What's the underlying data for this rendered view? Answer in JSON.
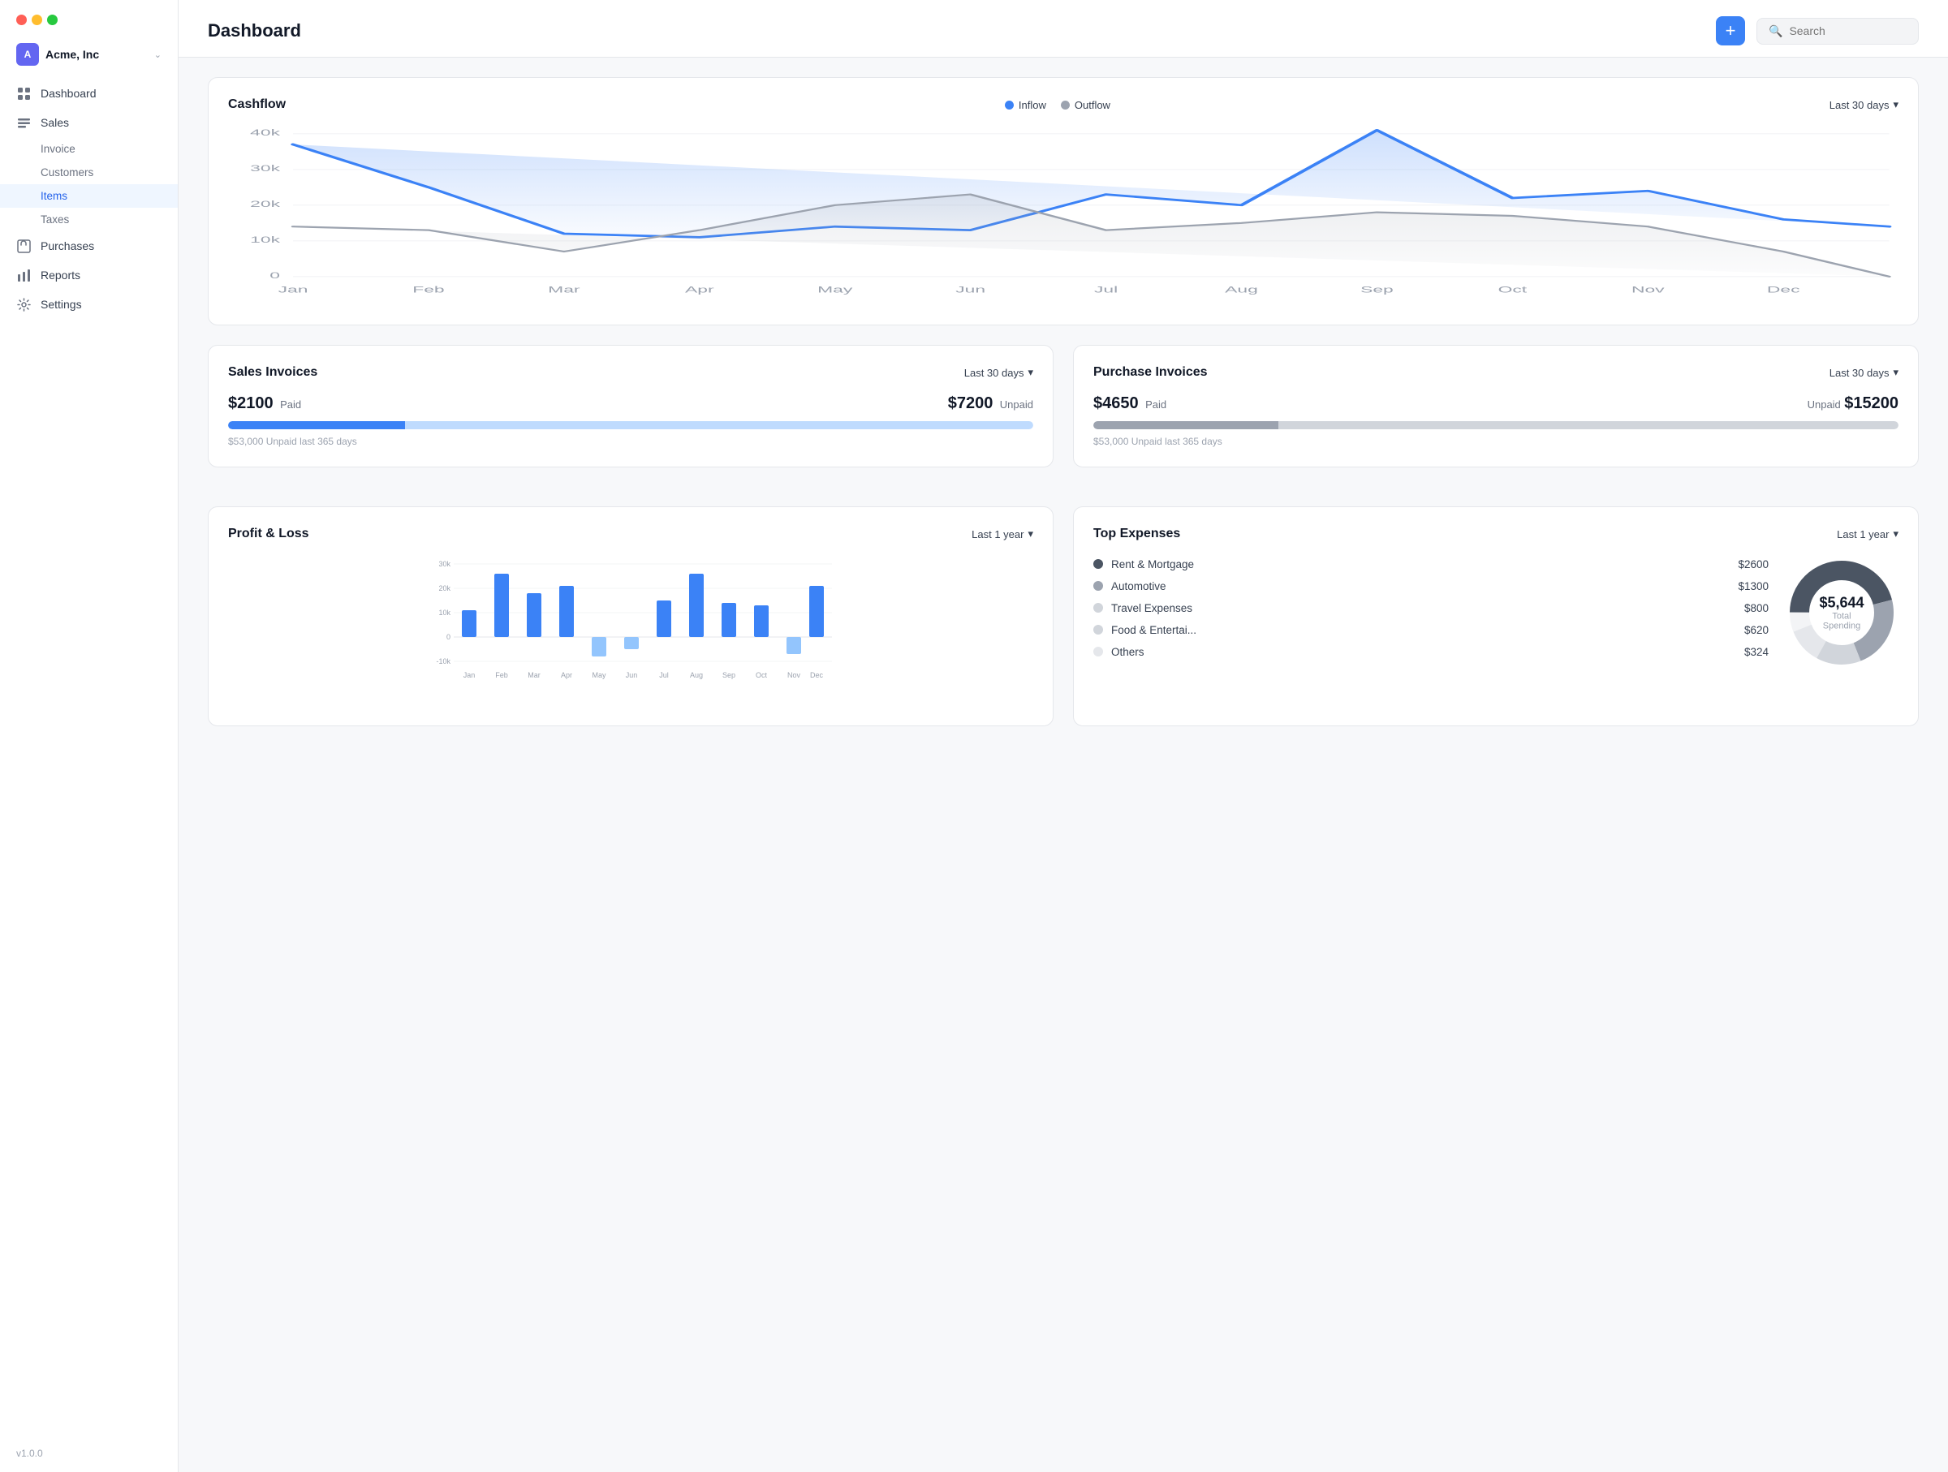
{
  "sidebar": {
    "company": "Acme, Inc",
    "nav": [
      {
        "id": "dashboard",
        "label": "Dashboard",
        "icon": "⊞",
        "active": false,
        "sub": []
      },
      {
        "id": "sales",
        "label": "Sales",
        "icon": "🗒",
        "active": false,
        "sub": [
          {
            "id": "invoice",
            "label": "Invoice",
            "active": false
          },
          {
            "id": "customers",
            "label": "Customers",
            "active": false
          },
          {
            "id": "items",
            "label": "Items",
            "active": true
          },
          {
            "id": "taxes",
            "label": "Taxes",
            "active": false
          }
        ]
      },
      {
        "id": "purchases",
        "label": "Purchases",
        "icon": "🛒",
        "active": false,
        "sub": []
      },
      {
        "id": "reports",
        "label": "Reports",
        "icon": "📊",
        "active": false,
        "sub": []
      },
      {
        "id": "settings",
        "label": "Settings",
        "icon": "⚙",
        "active": false,
        "sub": []
      }
    ],
    "version": "v1.0.0"
  },
  "header": {
    "title": "Dashboard",
    "plus_label": "+",
    "search_placeholder": "Search"
  },
  "cashflow": {
    "title": "Cashflow",
    "inflow_label": "Inflow",
    "outflow_label": "Outflow",
    "period": "Last 30 days",
    "months": [
      "Jan",
      "Feb",
      "Mar",
      "Apr",
      "May",
      "Jun",
      "Jul",
      "Aug",
      "Sep",
      "Oct",
      "Nov",
      "Dec"
    ],
    "y_labels": [
      "40k",
      "30k",
      "20k",
      "10k",
      "0"
    ]
  },
  "sales_invoices": {
    "title": "Sales Invoices",
    "period": "Last 30 days",
    "paid_amount": "$2100",
    "paid_label": "Paid",
    "unpaid_amount": "$7200",
    "unpaid_label": "Unpaid",
    "paid_pct": 22,
    "unpaid_pct": 78,
    "footnote": "$53,000 Unpaid last 365 days"
  },
  "purchase_invoices": {
    "title": "Purchase Invoices",
    "period": "Last 30 days",
    "paid_amount": "$4650",
    "paid_label": "Paid",
    "unpaid_amount": "$15200",
    "unpaid_label": "Unpaid",
    "paid_pct": 23,
    "unpaid_pct": 77,
    "footnote": "$53,000 Unpaid last 365 days"
  },
  "profit_loss": {
    "title": "Profit & Loss",
    "period": "Last 1 year",
    "months": [
      "Jan",
      "Feb",
      "Mar",
      "Apr",
      "May",
      "Jun",
      "Jul",
      "Aug",
      "Sep",
      "Oct",
      "Nov",
      "Dec"
    ],
    "y_labels": [
      "30k",
      "20k",
      "10k",
      "0",
      "-10k"
    ],
    "bars": [
      {
        "month": "Jan",
        "value": 11
      },
      {
        "month": "Feb",
        "value": 26
      },
      {
        "month": "Mar",
        "value": 18
      },
      {
        "month": "Apr",
        "value": 21
      },
      {
        "month": "May",
        "value": -8
      },
      {
        "month": "Jun",
        "value": -5
      },
      {
        "month": "Jul",
        "value": 15
      },
      {
        "month": "Aug",
        "value": 26
      },
      {
        "month": "Sep",
        "value": 14
      },
      {
        "month": "Oct",
        "value": 13
      },
      {
        "month": "Nov",
        "value": -7
      },
      {
        "month": "Dec",
        "value": 21
      }
    ]
  },
  "top_expenses": {
    "title": "Top Expenses",
    "period": "Last 1 year",
    "total": "$5,644",
    "total_label": "Total Spending",
    "items": [
      {
        "name": "Rent & Mortgage",
        "amount": "$2600",
        "color": "#4b5563",
        "pct": 46
      },
      {
        "name": "Automotive",
        "amount": "$1300",
        "color": "#9ca3af",
        "pct": 23
      },
      {
        "name": "Travel Expenses",
        "amount": "$800",
        "color": "#d1d5db",
        "pct": 14
      },
      {
        "name": "Food & Entertai...",
        "amount": "$620",
        "color": "#e5e7eb",
        "pct": 11
      },
      {
        "name": "Others",
        "amount": "$324",
        "color": "#f3f4f6",
        "pct": 6
      }
    ]
  }
}
